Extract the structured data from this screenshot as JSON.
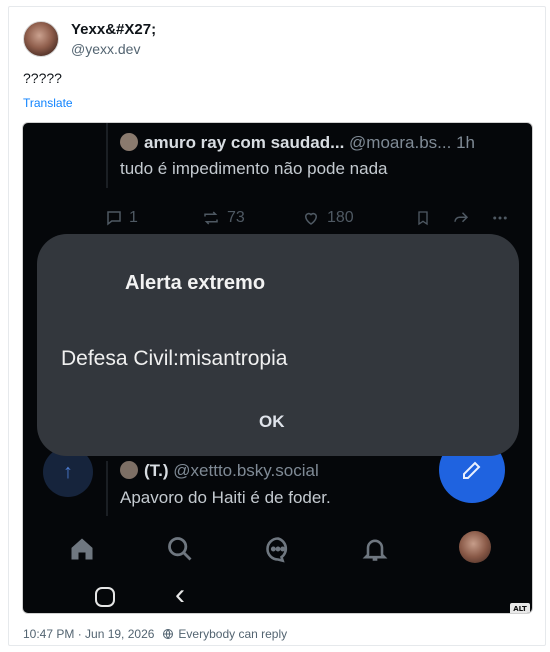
{
  "post": {
    "display_name": "Yexx&#X27;",
    "handle": "@yexx.dev",
    "text": "?????",
    "translate_label": "Translate",
    "timestamp": "10:47 PM · Jun 19, 2026",
    "reply_setting": "Everybody can reply"
  },
  "embed": {
    "alt_badge": "ALT",
    "quoted_post": {
      "name": "amuro ray com saudad...",
      "handle": "@moara.bs...",
      "age": "1h",
      "text": "tudo é impedimento não pode nada",
      "reply_count": "1",
      "repost_count": "73",
      "like_count": "180"
    },
    "dialog": {
      "title": "Alerta extremo",
      "body": "Defesa Civil:misantropia",
      "ok_label": "OK"
    },
    "second_post": {
      "name": "(T.)",
      "handle": "@xettto.bsky.social",
      "text": "Apavoro do Haiti é de foder."
    },
    "icons": [
      "reply-icon",
      "repost-icon",
      "like-icon",
      "bookmark-icon",
      "share-icon",
      "more-icon",
      "home-icon",
      "search-icon",
      "chat-icon",
      "bell-icon",
      "compose-icon",
      "arrow-up-icon"
    ]
  },
  "colors": {
    "link": "#1083fe",
    "dialog_bg": "#33373d",
    "fab": "#1f63e0"
  }
}
